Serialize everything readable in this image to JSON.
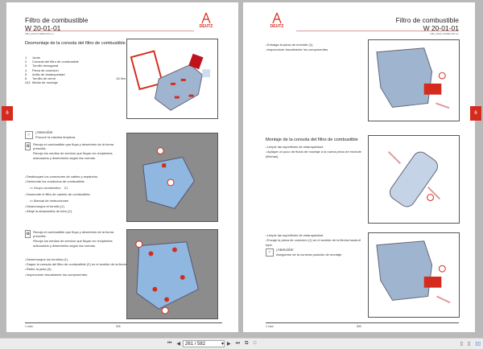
{
  "left_page": {
    "title": "Filtro de combustible",
    "code": "W 20-01-01",
    "doc_id": "OBJ_DOKU-50839-001.fm",
    "heading": "Desmontaje de la consola del filtro de combustible",
    "parts": [
      {
        "n": "1",
        "label": "Junta",
        "value": ""
      },
      {
        "n": "2",
        "label": "Consola del filtro de combustible",
        "value": ""
      },
      {
        "n": "3",
        "label": "Tornillo hexagonal",
        "value": ""
      },
      {
        "n": "4",
        "label": "Pieza de conexión",
        "value": ""
      },
      {
        "n": "5",
        "label": "Anillo de estanqueidad",
        "value": ""
      },
      {
        "n": "6",
        "label": "Tornillo de cierre",
        "value": "34  Nm"
      },
      {
        "n": "242",
        "label": "Medio de montaje",
        "value": ""
      }
    ],
    "attention_title": "¡Atención!",
    "attention_text": "Procure la máxima limpieza.",
    "env1": "Recoja el combustible que fluya y deséchelo de la forma prescrita.",
    "env2": "Recoja los medios de servicio que fluyan en recipientes adecuados y deséchelos según las normas.",
    "steps1": [
      "Desbloquee los conectores de cables y sepárelos.",
      "Desmonte los conductos de combustible."
    ],
    "ref1_label": "Grupo constructivo",
    "ref1_value": "21",
    "steps2": [
      "Desmonte el filtro de cambio de combustible."
    ],
    "ref2_label": "Manual de instrucciones",
    "steps3": [
      "Desenrosque el tornillo (1).",
      "Afloje la abrazadera de tubo (2)."
    ],
    "env3": "Recoja el combustible que fluya y deséchelo de la forma prescrita.",
    "env4": "Recoja los medios de servicio que fluyan en recipientes adecuados y deséchelos según las normas.",
    "steps4": [
      "Desenrosque los tornillos (1).",
      "Saque la consola del filtro de combustible (2) en el sentido de la flecha.",
      "Retire la junta (3).",
      "Inspeccione visualmente los componentes."
    ],
    "footer_left": "© 2020",
    "page_num": "2/6",
    "tab": "6",
    "logo": "DEUTZ"
  },
  "right_page": {
    "title": "Filtro de combustible",
    "code": "W 20-01-01",
    "doc_id": "OBJ_DOKU-50839-001.fm",
    "steps1": [
      "Extraiga la pieza de enchufe (1).",
      "Inspeccione visualmente los componentes."
    ],
    "heading": "Montaje de la consola del filtro de combustible",
    "steps2": [
      "Limpie las superficies de estanqueidad.",
      "Aplique un poco de fluido de montaje a la nueva pieza de enchufe (flechas)."
    ],
    "steps3": [
      "Limpie las superficies de estanqueidad.",
      "Encaje la pieza de conexión (1) en el sentido de la flecha hasta el tope."
    ],
    "attention_title": "¡Atención!",
    "attention_text": "Asegúrese de la correcta posición de montaje.",
    "footer_left": "© 2020",
    "page_num": "3/6",
    "tab": "6",
    "logo": "DEUTZ"
  },
  "toolbar": {
    "page_value": "261 / 582"
  }
}
